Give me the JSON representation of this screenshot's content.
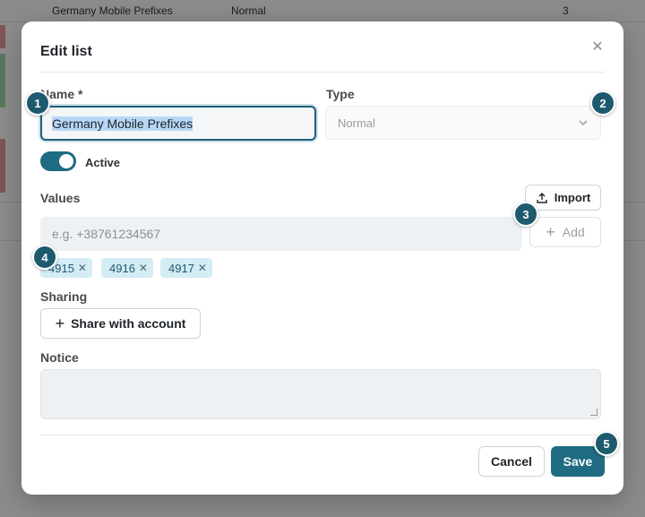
{
  "background": {
    "row": {
      "name": "Germany Mobile Prefixes",
      "type": "Normal",
      "count": "3"
    }
  },
  "modal": {
    "title": "Edit list",
    "close_icon": "close-icon",
    "name_label": "Name *",
    "name_value": "Germany Mobile Prefixes",
    "type_label": "Type",
    "type_value": "Normal",
    "active_label": "Active",
    "active_on": true,
    "values_label": "Values",
    "import_label": "Import",
    "values_placeholder": "e.g. +38761234567",
    "add_label": "Add",
    "tags": [
      "4915",
      "4916",
      "4917"
    ],
    "sharing_label": "Sharing",
    "share_button_label": "Share with account",
    "notice_label": "Notice",
    "notice_value": "",
    "cancel_label": "Cancel",
    "save_label": "Save"
  },
  "badges": [
    "1",
    "2",
    "3",
    "4",
    "5"
  ],
  "colors": {
    "accent": "#1f6b82",
    "tag_bg": "#d4ecf4",
    "badge": "#1e5a6e"
  }
}
